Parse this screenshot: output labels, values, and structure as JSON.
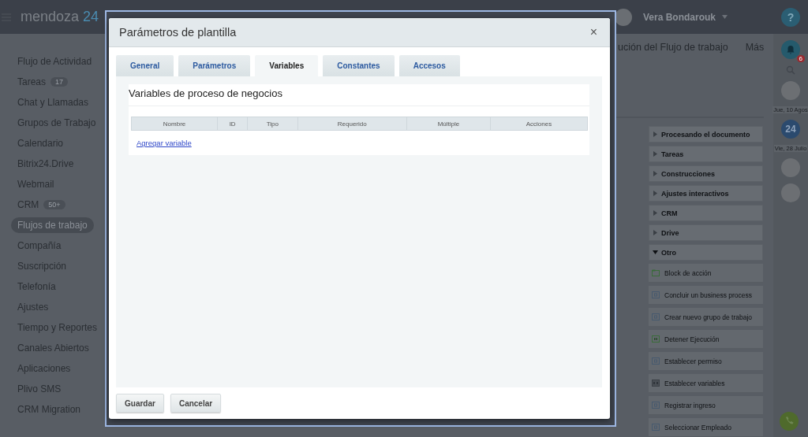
{
  "header": {
    "logo": {
      "name": "mendoza",
      "number": "24"
    },
    "user": "Vera Bondarouk",
    "help": "?"
  },
  "sidebar": {
    "items": [
      {
        "label": "Flujo de Actividad",
        "selected": false
      },
      {
        "label": "Tareas",
        "badge": "17",
        "selected": false
      },
      {
        "label": "Chat y Llamadas",
        "selected": false
      },
      {
        "label": "Grupos de Trabajo",
        "selected": false
      },
      {
        "label": "Calendario",
        "selected": false
      },
      {
        "label": "Bitrix24.Drive",
        "selected": false
      },
      {
        "label": "Webmail",
        "selected": false
      },
      {
        "label": "CRM",
        "badge": "50+",
        "selected": false
      },
      {
        "label": "Flujos de trabajo",
        "selected": true
      },
      {
        "label": "Compañía",
        "selected": false
      },
      {
        "label": "Suscripción",
        "selected": false
      },
      {
        "label": "Telefonía",
        "selected": false
      },
      {
        "label": "Ajustes",
        "selected": false
      },
      {
        "label": "Tiempo y Reportes",
        "selected": false
      },
      {
        "label": "Canales Abiertos",
        "selected": false
      },
      {
        "label": "Aplicaciones",
        "selected": false
      },
      {
        "label": "Plivo SMS",
        "selected": false
      },
      {
        "label": "CRM Migration",
        "selected": false
      }
    ]
  },
  "toolbar": {
    "items": [
      "ución del Flujo de trabajo",
      "Más"
    ]
  },
  "activity_panel": {
    "groups": [
      {
        "label": "Procesando el documento",
        "expanded": false
      },
      {
        "label": "Tareas",
        "expanded": false
      },
      {
        "label": "Construcciones",
        "expanded": false
      },
      {
        "label": "Ajustes interactivos",
        "expanded": false
      },
      {
        "label": "CRM",
        "expanded": false
      },
      {
        "label": "Drive",
        "expanded": false
      },
      {
        "label": "Otro",
        "expanded": true,
        "children": [
          {
            "label": "Block de acción",
            "kind": "block"
          },
          {
            "label": "Concluir un business process",
            "kind": "generic"
          },
          {
            "label": "Crear nuevo grupo de trabajo",
            "kind": "generic"
          },
          {
            "label": "Detener Ejecución",
            "kind": "stop"
          },
          {
            "label": "Establecer permiso",
            "kind": "generic"
          },
          {
            "label": "Establecer variables",
            "kind": "variables"
          },
          {
            "label": "Registrar ingreso",
            "kind": "generic"
          },
          {
            "label": "Seleccionar Empleado",
            "kind": "generic"
          }
        ]
      }
    ]
  },
  "right_rail": {
    "items": [
      {
        "kind": "bell",
        "badge": "6"
      },
      {
        "kind": "search"
      },
      {
        "kind": "avatar"
      },
      {
        "kind": "date",
        "text": "Jue, 10 Agos"
      },
      {
        "kind": "logo",
        "text": "24"
      },
      {
        "kind": "date",
        "text": "Vie, 28 Julio"
      },
      {
        "kind": "avatar"
      },
      {
        "kind": "avatar"
      }
    ]
  },
  "dialog": {
    "title": "Parámetros de plantilla",
    "close": "×",
    "tabs": [
      {
        "label": "General",
        "selected": false
      },
      {
        "label": "Parámetros",
        "selected": false
      },
      {
        "label": "Variables",
        "selected": true
      },
      {
        "label": "Constantes",
        "selected": false
      },
      {
        "label": "Accesos",
        "selected": false
      }
    ],
    "section_title": "Variables de proceso de negocios",
    "table": {
      "columns": [
        "Nombre",
        "ID",
        "Tipo",
        "Requerido",
        "Múltiple",
        "Acciones"
      ]
    },
    "link": "Agregar variable",
    "buttons": [
      "Guardar",
      "Cancelar"
    ]
  }
}
